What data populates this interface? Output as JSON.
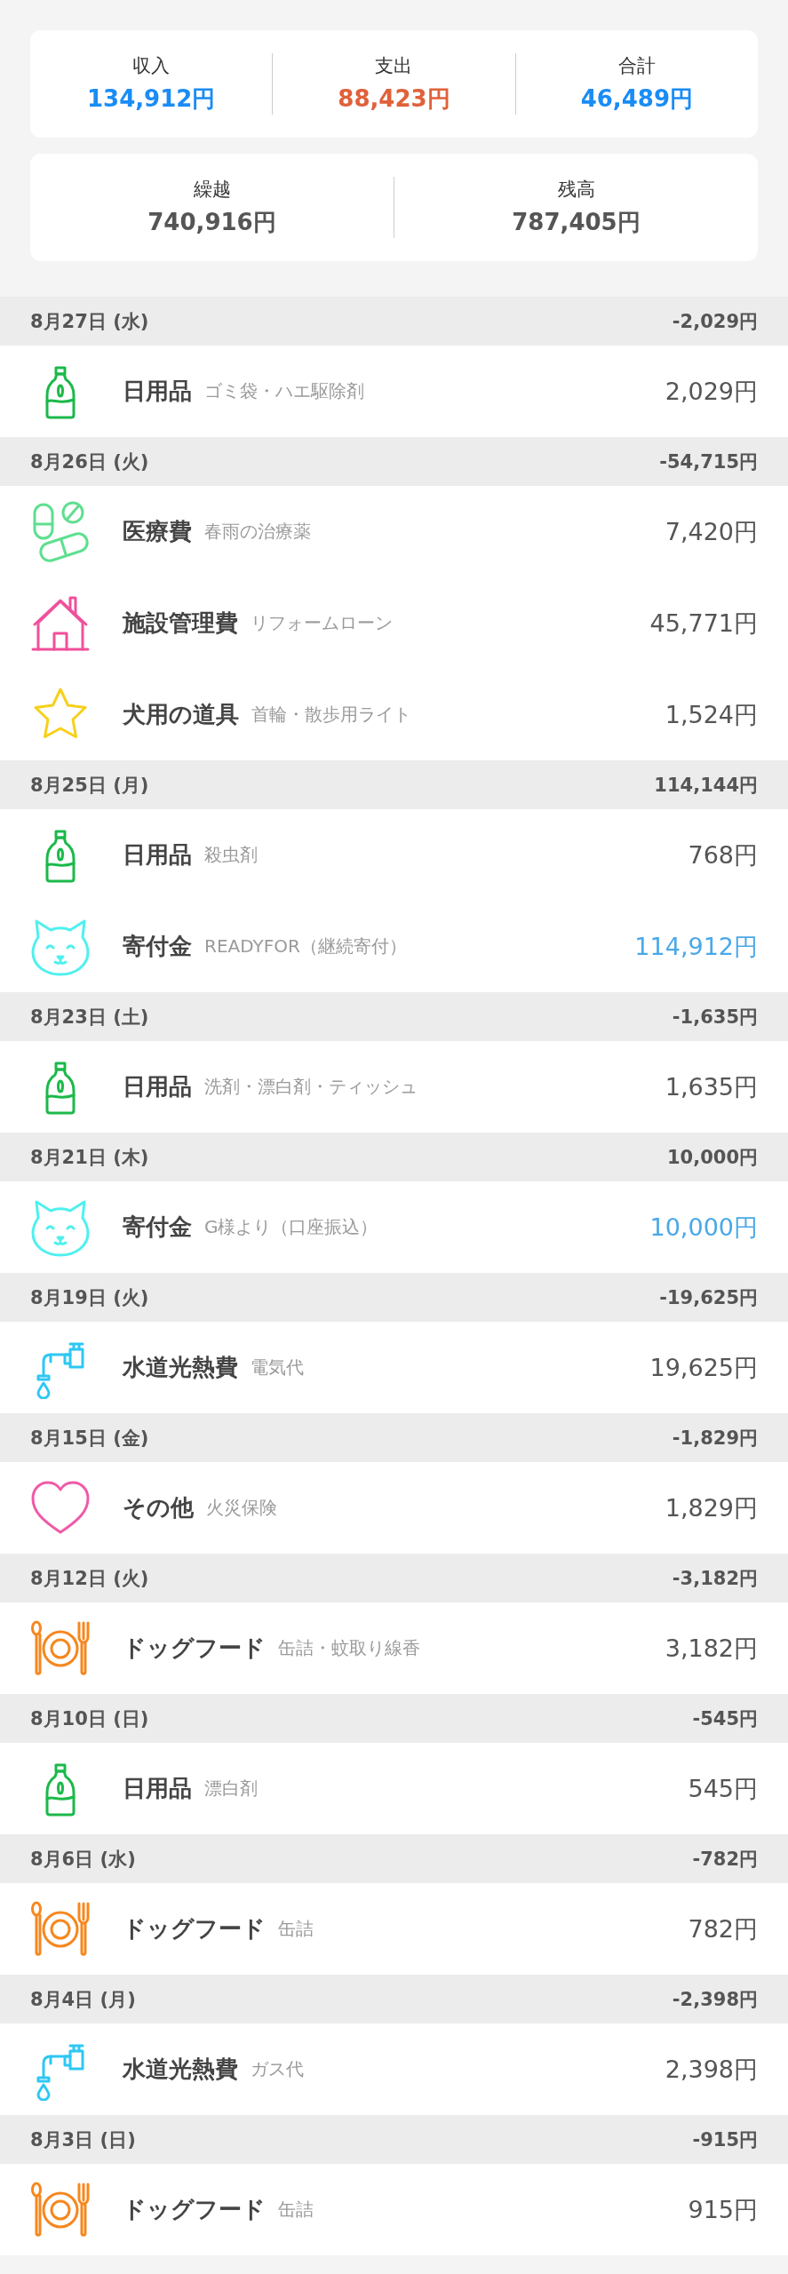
{
  "summary": [
    {
      "label": "収入",
      "value": "134,912円",
      "color": "#1a8cf5"
    },
    {
      "label": "支出",
      "value": "88,423円",
      "color": "#e0613a"
    },
    {
      "label": "合計",
      "value": "46,489円",
      "color": "#1a8cf5"
    }
  ],
  "balance": [
    {
      "label": "繰越",
      "value": "740,916円"
    },
    {
      "label": "残高",
      "value": "787,405円"
    }
  ],
  "days": [
    {
      "date": "8月27日 (水)",
      "total": "-2,029円",
      "entries": [
        {
          "kind": "bottle",
          "category": "日用品",
          "note": "ゴミ袋・ハエ駆除剤",
          "amount": "2,029円",
          "income": false
        }
      ]
    },
    {
      "date": "8月26日 (火)",
      "total": "-54,715円",
      "entries": [
        {
          "kind": "pills",
          "category": "医療費",
          "note": "春雨の治療薬",
          "amount": "7,420円",
          "income": false
        },
        {
          "kind": "house",
          "category": "施設管理費",
          "note": "リフォームローン",
          "amount": "45,771円",
          "income": false
        },
        {
          "kind": "star",
          "category": "犬用の道具",
          "note": "首輪・散歩用ライト",
          "amount": "1,524円",
          "income": false
        }
      ]
    },
    {
      "date": "8月25日 (月)",
      "total": "114,144円",
      "entries": [
        {
          "kind": "bottle",
          "category": "日用品",
          "note": "殺虫剤",
          "amount": "768円",
          "income": false
        },
        {
          "kind": "cat",
          "category": "寄付金",
          "note": "READYFOR（継続寄付）",
          "amount": "114,912円",
          "income": true
        }
      ]
    },
    {
      "date": "8月23日 (土)",
      "total": "-1,635円",
      "entries": [
        {
          "kind": "bottle",
          "category": "日用品",
          "note": "洗剤・漂白剤・ティッシュ",
          "amount": "1,635円",
          "income": false
        }
      ]
    },
    {
      "date": "8月21日 (木)",
      "total": "10,000円",
      "entries": [
        {
          "kind": "cat",
          "category": "寄付金",
          "note": "G様より（口座振込）",
          "amount": "10,000円",
          "income": true
        }
      ]
    },
    {
      "date": "8月19日 (火)",
      "total": "-19,625円",
      "entries": [
        {
          "kind": "faucet",
          "category": "水道光熱費",
          "note": "電気代",
          "amount": "19,625円",
          "income": false
        }
      ]
    },
    {
      "date": "8月15日 (金)",
      "total": "-1,829円",
      "entries": [
        {
          "kind": "heart",
          "category": "その他",
          "note": "火災保険",
          "amount": "1,829円",
          "income": false
        }
      ]
    },
    {
      "date": "8月12日 (火)",
      "total": "-3,182円",
      "entries": [
        {
          "kind": "food",
          "category": "ドッグフード",
          "note": "缶詰・蚊取り線香",
          "amount": "3,182円",
          "income": false
        }
      ]
    },
    {
      "date": "8月10日 (日)",
      "total": "-545円",
      "entries": [
        {
          "kind": "bottle",
          "category": "日用品",
          "note": "漂白剤",
          "amount": "545円",
          "income": false
        }
      ]
    },
    {
      "date": "8月6日 (水)",
      "total": "-782円",
      "entries": [
        {
          "kind": "food",
          "category": "ドッグフード",
          "note": "缶詰",
          "amount": "782円",
          "income": false
        }
      ]
    },
    {
      "date": "8月4日 (月)",
      "total": "-2,398円",
      "entries": [
        {
          "kind": "faucet",
          "category": "水道光熱費",
          "note": "ガス代",
          "amount": "2,398円",
          "income": false
        }
      ]
    },
    {
      "date": "8月3日 (日)",
      "total": "-915円",
      "entries": [
        {
          "kind": "food",
          "category": "ドッグフード",
          "note": "缶詰",
          "amount": "915円",
          "income": false
        }
      ]
    }
  ]
}
